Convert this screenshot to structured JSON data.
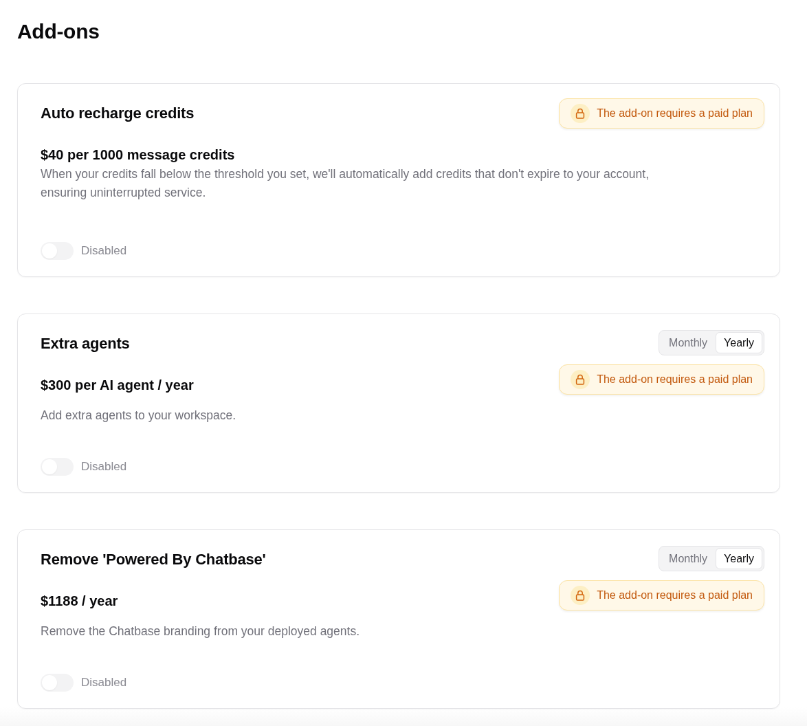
{
  "page": {
    "title": "Add-ons"
  },
  "addons": [
    {
      "title": "Auto recharge credits",
      "price": "$40 per 1000 message credits",
      "description": "When your credits fall below the threshold you set, we'll automatically add credits that don't expire to your account, ensuring uninterrupted service.",
      "notice": "The add-on requires a paid plan",
      "switch": {
        "on": false,
        "label": "Disabled"
      }
    },
    {
      "title": "Extra agents",
      "billing": [
        {
          "label": "Monthly",
          "selected": false
        },
        {
          "label": "Yearly",
          "selected": true
        }
      ],
      "price": "$300 per AI agent / year",
      "description": "Add extra agents to your workspace.",
      "notice": "The add-on requires a paid plan",
      "switch": {
        "on": false,
        "label": "Disabled"
      }
    },
    {
      "title": "Remove 'Powered By Chatbase'",
      "billing": [
        {
          "label": "Monthly",
          "selected": false
        },
        {
          "label": "Yearly",
          "selected": true
        }
      ],
      "price": "$1188 / year",
      "description": "Remove the Chatbase branding from your deployed agents.",
      "notice": "The add-on requires a paid plan",
      "switch": {
        "on": false,
        "label": "Disabled"
      }
    }
  ]
}
